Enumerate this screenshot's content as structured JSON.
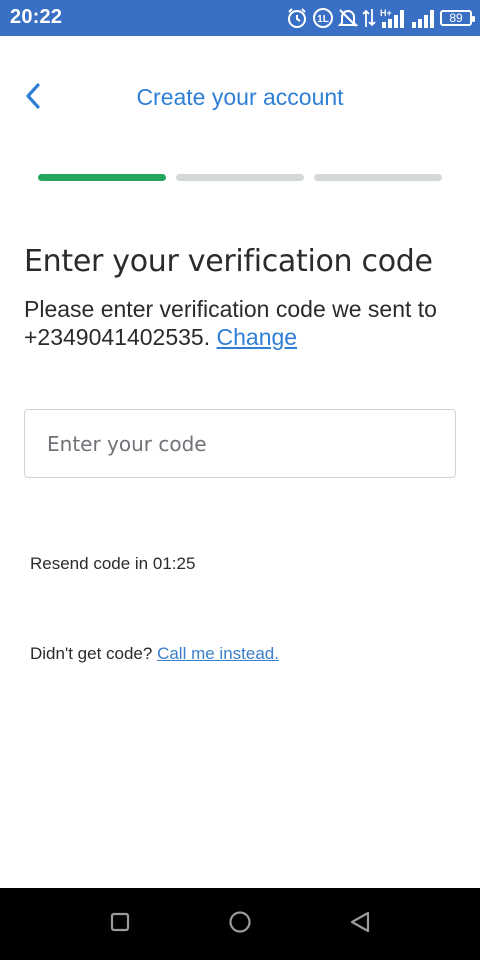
{
  "status_bar": {
    "time": "20:22",
    "battery": "89",
    "icons": [
      "alarm-icon",
      "volte-icon",
      "mute-icon",
      "data-arrows-icon",
      "hplus-signal-icon",
      "signal-icon",
      "battery-icon"
    ]
  },
  "header": {
    "title": "Create your account",
    "back_icon": "chevron-left-icon"
  },
  "progress": {
    "steps": 3,
    "current_step": 1,
    "active_color": "#23a55e",
    "inactive_color": "#d5d8d9"
  },
  "main": {
    "heading": "Enter your verification code",
    "desc_prefix": "Please enter verification code we sent to +2349041402535.",
    "change_link": "Change",
    "code_input": {
      "placeholder": "Enter your code",
      "value": ""
    },
    "resend_label": "Resend code in",
    "resend_timer": "01:25",
    "call_prompt": "Didn't get code?",
    "call_link": "Call me instead."
  },
  "nav_bar": {
    "buttons": [
      "recents-square-icon",
      "home-circle-icon",
      "back-triangle-icon"
    ]
  },
  "colors": {
    "status_bar": "#3a6fc6",
    "accent_blue": "#2f7fd6",
    "text": "#2b2b2b"
  }
}
